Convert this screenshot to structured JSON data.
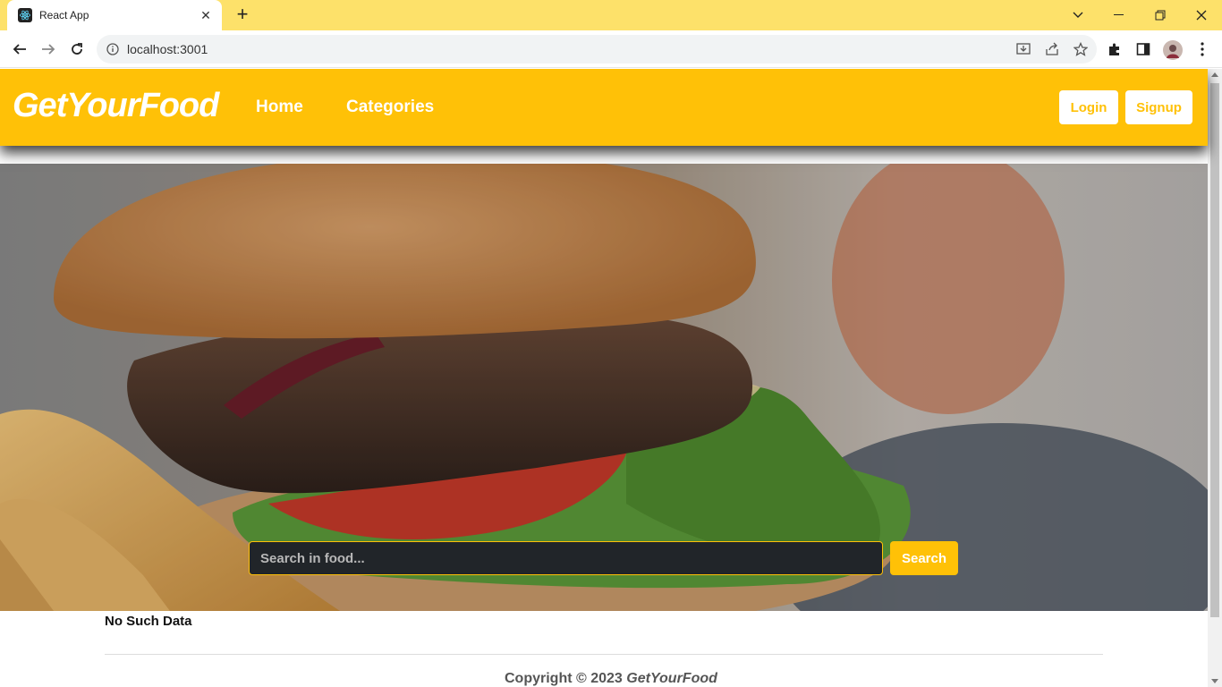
{
  "browser": {
    "tab_title": "React App",
    "url": "localhost:3001",
    "tab_close": "✕",
    "new_tab": "+"
  },
  "site": {
    "brand": "GetYourFood",
    "nav": [
      "Home",
      "Categories"
    ],
    "login": "Login",
    "signup": "Signup",
    "search_placeholder": "Search in food...",
    "search_button": "Search",
    "no_data": "No Such Data",
    "footer_prefix": "Copyright © 2023 ",
    "footer_brand": "GetYourFood"
  },
  "colors": {
    "accent": "#ffc107",
    "tabbar": "#fde16a"
  }
}
